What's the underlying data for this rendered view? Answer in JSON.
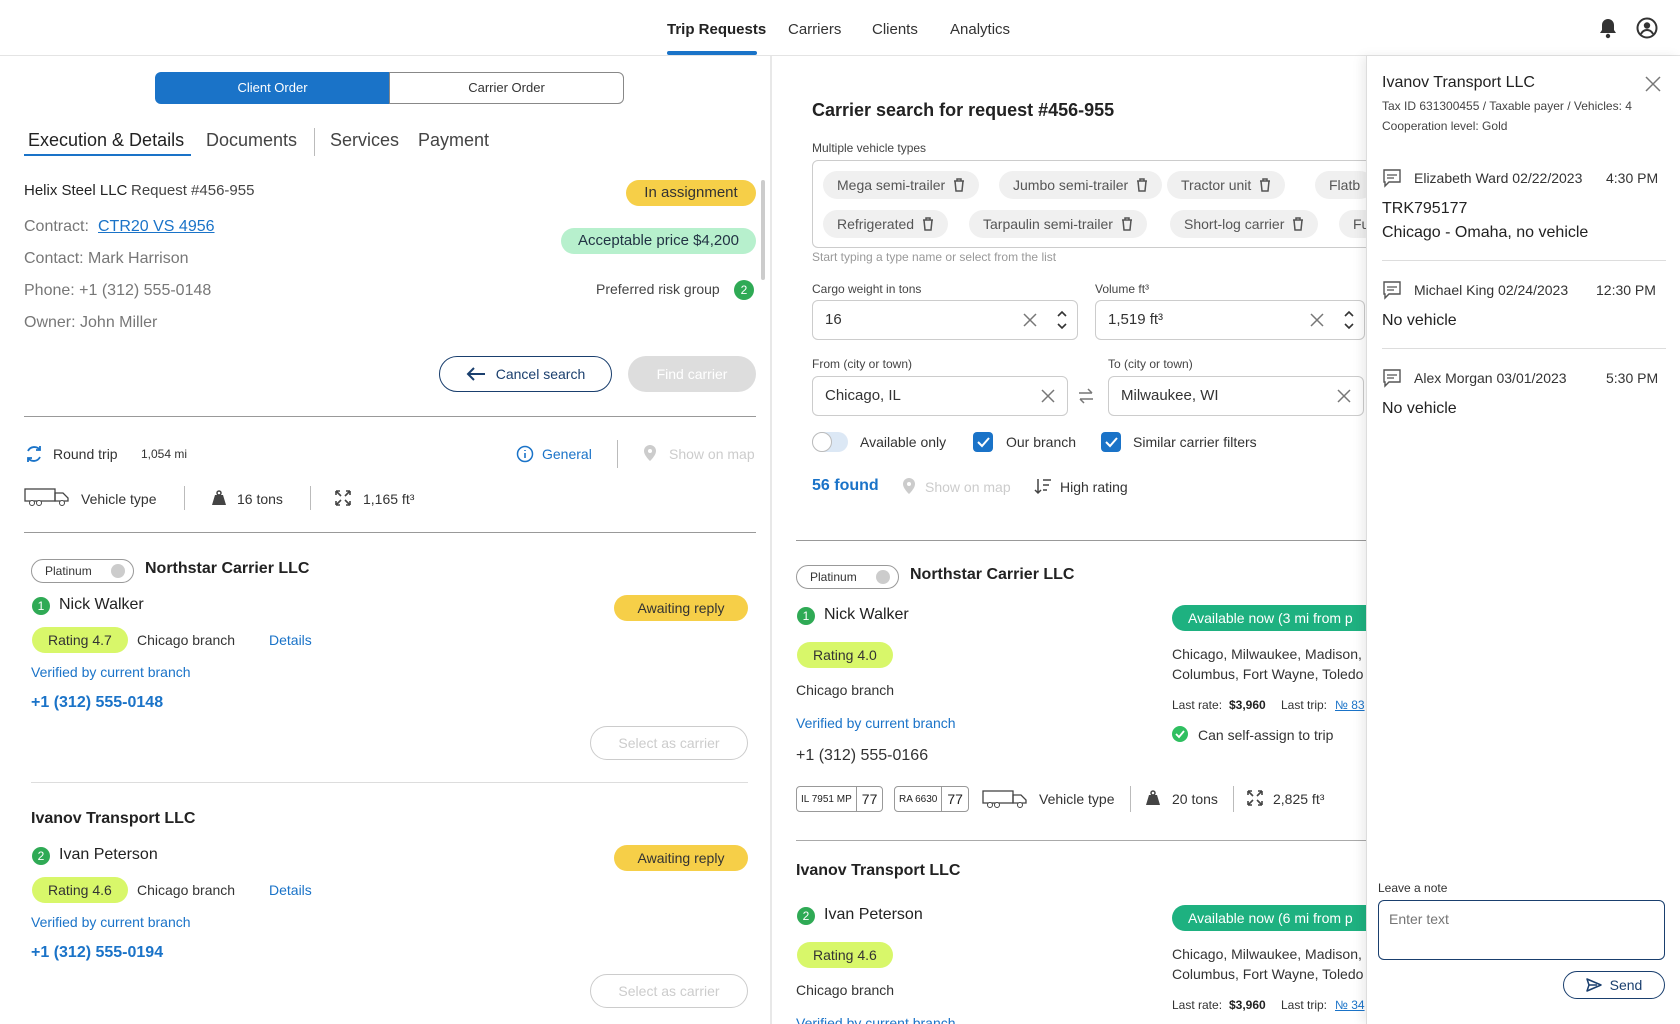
{
  "nav": {
    "tabs": [
      "Trip Requests",
      "Carriers",
      "Clients",
      "Analytics"
    ],
    "active": 0
  },
  "order_toggle": {
    "client": "Client Order",
    "carrier": "Carrier Order"
  },
  "detail_tabs": [
    "Execution & Details",
    "Documents",
    "Services",
    "Payment"
  ],
  "request": {
    "client": "Helix Steel LLC",
    "number": "Request #456-955",
    "status": "In assignment",
    "contract_label": "Contract:",
    "contract": "CTR20 VS 4956",
    "price": "Acceptable price $4,200",
    "contact": "Contact: Mark Harrison",
    "phone": "Phone: +1 (312) 555-0148",
    "owner": "Owner: John Miller",
    "risk_label": "Preferred risk group",
    "risk_value": "2",
    "cancel": "Cancel search",
    "find": "Find carrier"
  },
  "trip": {
    "round": "Round trip",
    "distance": "1,054 mi",
    "general": "General",
    "show_map": "Show on map",
    "vehicle": "Vehicle type",
    "weight": "16 tons",
    "volume": "1,165 ft³"
  },
  "left_carriers": [
    {
      "tier": "Platinum",
      "name": "Northstar Carrier LLC",
      "num": "1",
      "person": "Nick Walker",
      "status": "Awaiting reply",
      "rating": "Rating 4.7",
      "branch": "Chicago branch",
      "details": "Details",
      "verified": "Verified by current branch",
      "phone": "+1 (312) 555-0148",
      "select": "Select as carrier"
    },
    {
      "tier": "",
      "name": "Ivanov Transport LLC",
      "num": "2",
      "person": "Ivan Peterson",
      "status": "Awaiting reply",
      "rating": "Rating 4.6",
      "branch": "Chicago branch",
      "details": "Details",
      "verified": "Verified by current branch",
      "phone": "+1 (312) 555-0194",
      "select": "Select as carrier"
    }
  ],
  "search": {
    "title": "Carrier search for request #456-955",
    "vehicle_label": "Multiple vehicle types",
    "chips_row1": [
      "Mega semi-trailer",
      "Jumbo semi-trailer",
      "Tractor unit",
      "Flatb"
    ],
    "chips_row2": [
      "Refrigerated",
      "Tarpaulin semi-trailer",
      "Short-log carrier",
      "Fu"
    ],
    "hint": "Start typing a type name or select from the list",
    "weight_label": "Cargo weight in tons",
    "weight": "16",
    "volume_label": "Volume ft³",
    "volume": "1,519 ft³",
    "from_label": "From (city or town)",
    "from": "Chicago, IL",
    "to_label": "To (city or town)",
    "to": "Milwaukee, WI",
    "available_only": "Available only",
    "our_branch": "Our branch",
    "similar": "Similar carrier filters",
    "found": "56 found",
    "show_map": "Show on map",
    "sort": "High rating"
  },
  "right_carriers": [
    {
      "tier": "Platinum",
      "name": "Northstar Carrier LLC",
      "num": "1",
      "person": "Nick Walker",
      "avail": "Available now (3 mi from p",
      "rating": "Rating 4.0",
      "cities1": "Chicago, Milwaukee, Madison, I",
      "cities2": "Columbus, Fort Wayne, Toledo",
      "branch": "Chicago branch",
      "last_rate_label": "Last rate:",
      "last_rate": "$3,960",
      "last_trip_label": "Last trip:",
      "last_trip": "№ 83",
      "verified": "Verified by current branch",
      "self_assign": "Can self-assign to trip",
      "phone": "+1 (312) 555-0166",
      "plate1": "IL 7951 MP",
      "plate1_num": "77",
      "plate2": "RA 6630",
      "plate2_num": "77",
      "vehicle": "Vehicle type",
      "weight": "20 tons",
      "volume": "2,825 ft³"
    },
    {
      "tier": "",
      "name": "Ivanov Transport LLC",
      "num": "2",
      "person": "Ivan Peterson",
      "avail": "Available now (6 mi from p",
      "rating": "Rating 4.6",
      "cities1": "Chicago, Milwaukee, Madison, I",
      "cities2": "Columbus, Fort Wayne, Toledo",
      "branch": "Chicago branch",
      "last_rate_label": "Last rate:",
      "last_rate": "$3,960",
      "last_trip_label": "Last trip:",
      "last_trip": "№ 34",
      "verified": "Verified by current branch"
    }
  ],
  "panel": {
    "company": "Ivanov Transport LLC",
    "tax": "Tax ID 631300455 / Taxable payer / Vehicles: 4",
    "coop": "Cooperation level: Gold",
    "notes": [
      {
        "author": "Elizabeth Ward 02/22/2023",
        "time": "4:30 PM",
        "line1": "TRK795177",
        "line2": "Chicago - Omaha, no vehicle"
      },
      {
        "author": "Michael King 02/24/2023",
        "time": "12:30 PM",
        "line1": "No vehicle"
      },
      {
        "author": "Alex Morgan 03/01/2023",
        "time": "5:30 PM",
        "line1": "No vehicle"
      }
    ],
    "note_label": "Leave a note",
    "note_placeholder": "Enter text",
    "send": "Send"
  },
  "colors": {
    "accent": "#1a73c8",
    "yellow": "#f6cf48",
    "lime": "#d8f76a",
    "green": "#1eb180"
  }
}
